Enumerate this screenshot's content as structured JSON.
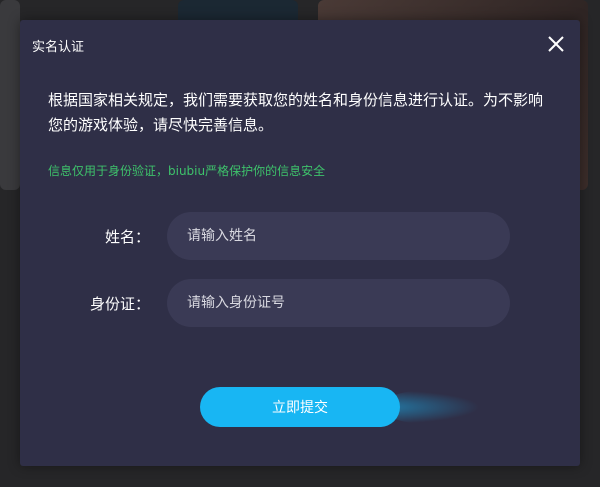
{
  "modal": {
    "title": "实名认证",
    "notice": "根据国家相关规定，我们需要获取您的姓名和身份信息进行认证。为不影响您的游戏体验，请尽快完善信息。",
    "privacy_note": "信息仅用于身份验证，biubiu严格保护你的信息安全",
    "fields": {
      "name": {
        "label": "姓名：",
        "placeholder": "请输入姓名",
        "value": ""
      },
      "id_number": {
        "label": "身份证：",
        "placeholder": "请输入身份证号",
        "value": ""
      }
    },
    "submit_label": "立即提交",
    "close_icon": "close-icon"
  },
  "colors": {
    "modal_bg": "#2f2f47",
    "field_bg": "#3a3a55",
    "accent": "#18b6f3",
    "privacy_green": "#3ec26b"
  }
}
